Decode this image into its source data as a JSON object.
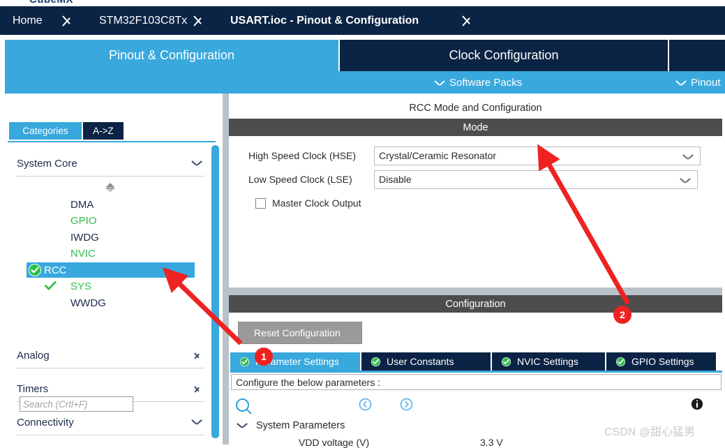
{
  "app": {
    "logo": "CubeMX",
    "watermark": "CSDN @甜心猛男"
  },
  "breadcrumb": {
    "items": [
      {
        "label": "Home"
      },
      {
        "label": "STM32F103C8Tx"
      },
      {
        "label": "USART.ioc - Pinout & Configuration"
      }
    ]
  },
  "main_tabs": [
    {
      "label": "Pinout & Configuration",
      "active": true
    },
    {
      "label": "Clock Configuration",
      "active": false
    },
    {
      "label": "",
      "active": false
    }
  ],
  "sub_bar": {
    "software_packs": "Software Packs",
    "pinout": "Pinout"
  },
  "sidebar": {
    "search": {
      "value": "",
      "placeholder": ""
    },
    "gear_icon": "gear-icon",
    "view_tabs": [
      {
        "label": "Categories",
        "active": true
      },
      {
        "label": "A->Z",
        "active": false
      }
    ],
    "groups": [
      {
        "label": "System Core",
        "expanded": true
      },
      {
        "label": "Analog",
        "expanded": false
      },
      {
        "label": "Timers",
        "expanded": false
      },
      {
        "label": "Connectivity",
        "expanded": false
      }
    ],
    "items": [
      {
        "label": "DMA",
        "state": "default",
        "selected": false
      },
      {
        "label": "GPIO",
        "state": "configured",
        "selected": false
      },
      {
        "label": "IWDG",
        "state": "default",
        "selected": false
      },
      {
        "label": "NVIC",
        "state": "configured",
        "selected": false
      },
      {
        "label": "RCC",
        "state": "configured",
        "selected": true
      },
      {
        "label": "SYS",
        "state": "configured",
        "selected": false
      },
      {
        "label": "WWDG",
        "state": "default",
        "selected": false
      }
    ]
  },
  "peripheral": {
    "title": "RCC Mode and Configuration",
    "mode_header": "Mode",
    "config_header": "Configuration",
    "fields": [
      {
        "label": "High Speed Clock (HSE)",
        "value": "Crystal/Ceramic Resonator"
      },
      {
        "label": "Low Speed Clock (LSE)",
        "value": "Disable"
      }
    ],
    "checkbox": {
      "label": "Master Clock Output",
      "checked": false
    },
    "reset_button": "Reset Configuration",
    "config_tabs": [
      {
        "label": "Parameter Settings",
        "active": true
      },
      {
        "label": "User Constants",
        "active": false
      },
      {
        "label": "NVIC Settings",
        "active": false
      },
      {
        "label": "GPIO Settings",
        "active": false
      }
    ],
    "configure_hint": "Configure the below parameters :",
    "param_search": {
      "value": "",
      "placeholder": "Search (Crtl+F)"
    },
    "param_groups": [
      {
        "label": "System Parameters",
        "expanded": true,
        "rows": [
          {
            "label": "VDD voltage (V)",
            "value": "3.3 V"
          }
        ]
      }
    ]
  },
  "annotations": [
    {
      "id": "1",
      "target": "parameter-settings-tab"
    },
    {
      "id": "2",
      "target": "hse-dropdown"
    }
  ],
  "colors": {
    "navy": "#0b2344",
    "accent_blue": "#38a8dd",
    "section_gray": "#4d4d4d",
    "configured_green": "#2fbf4a",
    "annotation_red": "#ef2222"
  }
}
